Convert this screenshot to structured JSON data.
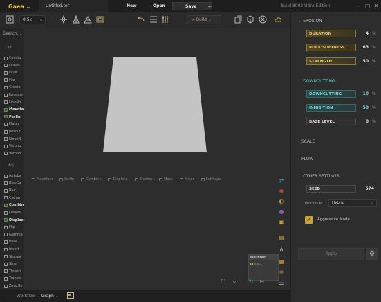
{
  "titlebar": {
    "brand": "Gaea",
    "brand_chevron": "⌄",
    "file_tab": "Untitled.tor",
    "menu_new": "New",
    "menu_open": "Open",
    "menu_save": "Save",
    "menu_plus": "+",
    "build_info": "Build 8002 Ultra Edition",
    "min": "—",
    "max": "▢",
    "close": "✕"
  },
  "toolbar": {
    "resolution": "0.5k",
    "resolution_chevron": "⌄",
    "build_label": "Build"
  },
  "left_panel": {
    "search_placeholder": "Search...",
    "primitives_header": "Pri",
    "adjustments_header": "Adj",
    "primitives": [
      "Consta",
      "Dunes",
      "Fault",
      "File",
      "Gradie",
      "Igneous",
      "LineNo",
      "Mounta",
      "Perlin",
      "Plates",
      "Resour",
      "SlopeN",
      "Vorono",
      "Vorono"
    ],
    "bold_primitives": [
      7,
      8
    ],
    "adjustments": [
      "AutoLe",
      "BlasGa",
      "Blur",
      "Clamp",
      "Combin",
      "Denois",
      "Displac",
      "Flip",
      "Gamma",
      "Heal",
      "Invert",
      "Sharpe",
      "Sine",
      "Thresh",
      "Transfo",
      "Zero Be"
    ],
    "bold_adjustments": [
      4,
      6
    ]
  },
  "viewport": {
    "filters": [
      "Mountain",
      "Perlin",
      "Combine",
      "Displace",
      "Erosion",
      "Mask",
      "Mixer",
      "SatMaps"
    ],
    "mini_node_title": "Mountain",
    "mini_node_port": "Input"
  },
  "right_panel": {
    "erosion_header": "EROSION",
    "duration_label": "DURATION",
    "duration_value": "4",
    "duration_unit": "%",
    "rock_label": "ROCK SOFTNESS",
    "rock_value": "65",
    "rock_unit": "%",
    "strength_label": "STRENGTH",
    "strength_value": "50",
    "strength_unit": "%",
    "downcutting_header": "DOWNCUTTING",
    "downcutting_label": "DOWNCUTTING",
    "downcutting_value": "10",
    "downcutting_unit": "%",
    "inhibition_label": "INHIBITION",
    "inhibition_value": "50",
    "inhibition_unit": "%",
    "base_label": "BASE LEVEL",
    "base_value": "0",
    "base_unit": "%",
    "scale_header": "SCALE",
    "flow_header": "FLOW",
    "other_header": "OTHER SETTINGS",
    "seed_label": "SEED",
    "seed_value": "574",
    "process_label": "Process M",
    "process_value": "Hybrid",
    "aggressive_label": "Aggressive Mode",
    "aggressive_checked": true,
    "apply_label": "Apply"
  },
  "bottombar": {
    "workflow_label": "Workflow",
    "graph_label": "Graph",
    "graph_chevron": "⌄"
  },
  "colors": {
    "accent_gold": "#e8c24a",
    "teal": "#7ed7d7"
  }
}
